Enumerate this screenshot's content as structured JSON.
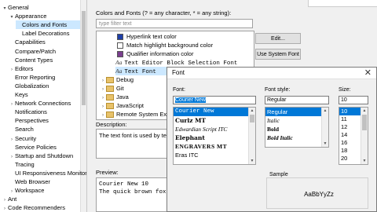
{
  "tree": {
    "items": [
      {
        "label": "General",
        "level": 0,
        "twisty": "v"
      },
      {
        "label": "Appearance",
        "level": 1,
        "twisty": "v"
      },
      {
        "label": "Colors and Fonts",
        "level": 2,
        "twisty": "",
        "selected": true
      },
      {
        "label": "Label Decorations",
        "level": 2,
        "twisty": ""
      },
      {
        "label": "Capabilities",
        "level": 1,
        "twisty": ""
      },
      {
        "label": "Compare/Patch",
        "level": 1,
        "twisty": ""
      },
      {
        "label": "Content Types",
        "level": 1,
        "twisty": ""
      },
      {
        "label": "Editors",
        "level": 1,
        "twisty": ">"
      },
      {
        "label": "Error Reporting",
        "level": 1,
        "twisty": ""
      },
      {
        "label": "Globalization",
        "level": 1,
        "twisty": ""
      },
      {
        "label": "Keys",
        "level": 1,
        "twisty": ""
      },
      {
        "label": "Network Connections",
        "level": 1,
        "twisty": ">"
      },
      {
        "label": "Notifications",
        "level": 1,
        "twisty": ""
      },
      {
        "label": "Perspectives",
        "level": 1,
        "twisty": ""
      },
      {
        "label": "Search",
        "level": 1,
        "twisty": ""
      },
      {
        "label": "Security",
        "level": 1,
        "twisty": ">"
      },
      {
        "label": "Service Policies",
        "level": 1,
        "twisty": ""
      },
      {
        "label": "Startup and Shutdown",
        "level": 1,
        "twisty": ">"
      },
      {
        "label": "Tracing",
        "level": 1,
        "twisty": ""
      },
      {
        "label": "UI Responsiveness Monitoring",
        "level": 1,
        "twisty": ""
      },
      {
        "label": "Web Browser",
        "level": 1,
        "twisty": ""
      },
      {
        "label": "Workspace",
        "level": 1,
        "twisty": ">"
      },
      {
        "label": "Ant",
        "level": 0,
        "twisty": ">"
      },
      {
        "label": "Code Recommenders",
        "level": 0,
        "twisty": ">"
      }
    ]
  },
  "prefs": {
    "section_title": "Colors and Fonts (? = any character, * = any string):",
    "filter_placeholder": "type filter text",
    "list_items": [
      {
        "kind": "swatch",
        "color": "#1e3fa8",
        "label": "Hyperlink text color"
      },
      {
        "kind": "swatch",
        "color": "#ffffff",
        "label": "Match highlight background color"
      },
      {
        "kind": "swatch",
        "color": "#7a3e8e",
        "label": "Qualifier information color"
      },
      {
        "kind": "font",
        "label": "Text Editor Block Selection Font"
      },
      {
        "kind": "font",
        "label": "Text Font",
        "selected": true
      },
      {
        "kind": "folder",
        "label": "Debug"
      },
      {
        "kind": "folder",
        "label": "Git"
      },
      {
        "kind": "folder",
        "label": "Java"
      },
      {
        "kind": "folder",
        "label": "JavaScript"
      },
      {
        "kind": "folder",
        "label": "Remote System Explorer"
      }
    ],
    "buttons": {
      "edit": "Edit...",
      "use_system_font": "Use System Font"
    },
    "description_label": "Description:",
    "description_text": "The text font is used by text editors.",
    "preview_label": "Preview:",
    "preview_lines": [
      "Courier New 10",
      "The quick brown fox jumps over the lazy dog."
    ]
  },
  "font_dialog": {
    "title": "Font",
    "close_glyph": "✕",
    "font_label": "Font:",
    "style_label": "Font style:",
    "size_label": "Size:",
    "font_value": "Courier New",
    "style_value": "Regular",
    "size_value": "10",
    "fonts": [
      "Courier New",
      "Curlz MT",
      "Edwardian Script ITC",
      "Elephant",
      "ENGRAVERS MT",
      "Eras ITC"
    ],
    "styles": [
      "Regular",
      "Italic",
      "Bold",
      "Bold Italic"
    ],
    "sizes": [
      "10",
      "11",
      "12",
      "14",
      "16",
      "18",
      "20"
    ],
    "sample_label": "Sample",
    "sample_text": "AaBbYyZz"
  }
}
